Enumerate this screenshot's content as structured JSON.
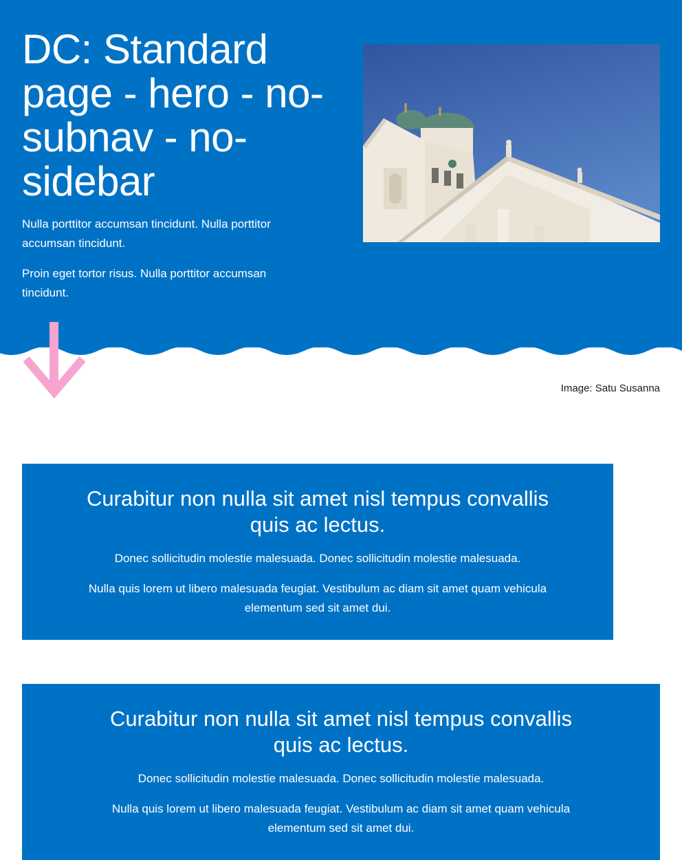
{
  "hero": {
    "title": "DC: Standard page - hero - no-subnav - no-sidebar",
    "paragraph_1": "Nulla porttitor accumsan tincidunt. Nulla porttitor accumsan tincidunt.",
    "paragraph_2": "Proin eget tortor risus. Nulla porttitor accumsan tincidunt.",
    "image_caption": "Image: Satu Susanna"
  },
  "banners": [
    {
      "title": "Curabitur non nulla sit amet nisl tempus convallis quis ac lectus.",
      "text_1": "Donec sollicitudin molestie malesuada. Donec sollicitudin molestie malesuada.",
      "text_2": "Nulla quis lorem ut libero malesuada feugiat. Vestibulum ac diam sit amet quam vehicula elementum sed sit amet dui."
    },
    {
      "title": "Curabitur non nulla sit amet nisl tempus convallis quis ac lectus.",
      "text_1": "Donec sollicitudin molestie malesuada. Donec sollicitudin molestie malesuada.",
      "text_2": "Nulla quis lorem ut libero malesuada feugiat. Vestibulum ac diam sit amet quam vehicula elementum sed sit amet dui."
    }
  ],
  "icons": {
    "scroll_arrow": "arrow-down-icon"
  },
  "colors": {
    "brand_blue": "#0072c6",
    "arrow_pink": "#f5a5cf",
    "background": "#ffffff"
  }
}
